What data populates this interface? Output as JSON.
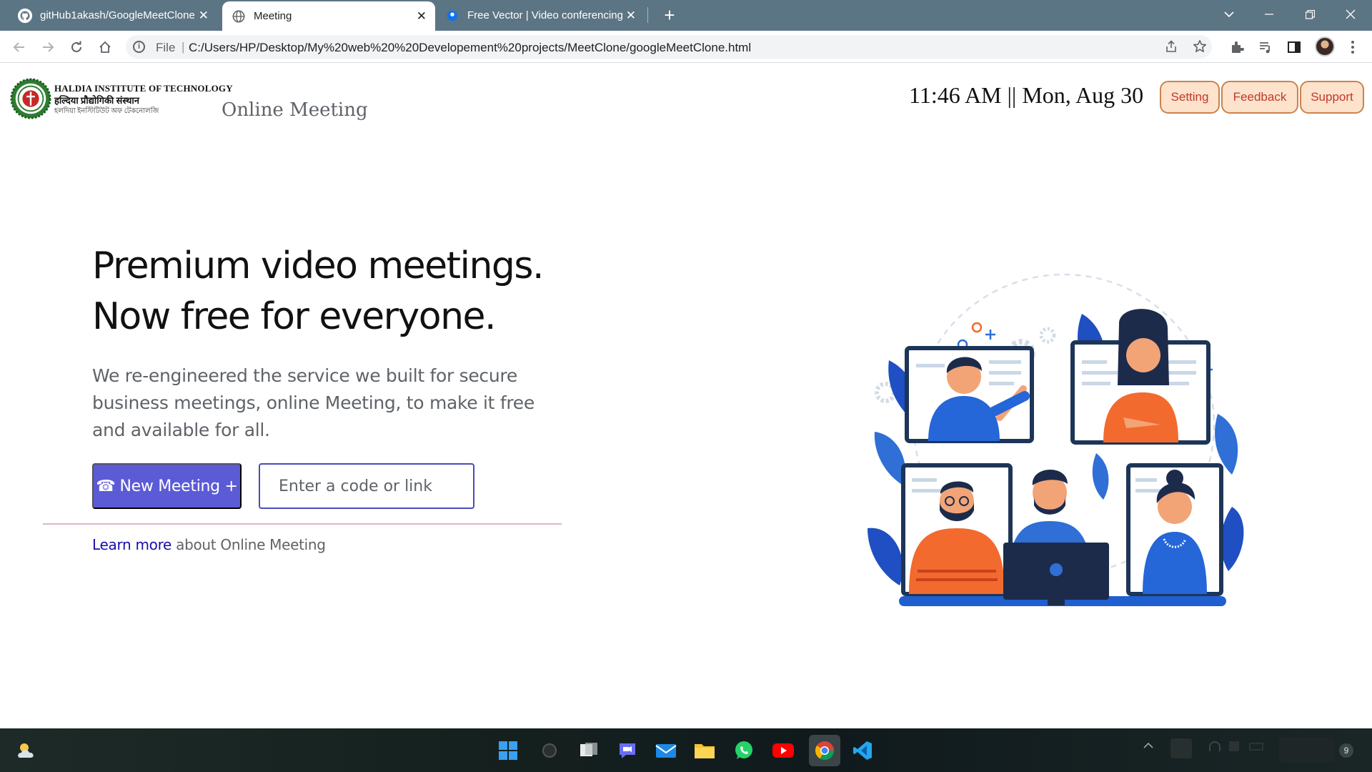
{
  "browser": {
    "tabs": [
      {
        "title": "gitHub1akash/GoogleMeetClone",
        "icon": "github-icon",
        "close": "✕"
      },
      {
        "title": "Meeting",
        "icon": "globe-icon",
        "close": "✕"
      },
      {
        "title": "Free Vector | Video conferencing",
        "icon": "freepik-icon",
        "close": "✕"
      }
    ],
    "new_tab": "+",
    "address": {
      "scheme_label": "File",
      "separator": "|",
      "url": "C:/Users/HP/Desktop/My%20web%20%20Developement%20projects/MeetClone/googleMeetClone.html"
    }
  },
  "header": {
    "institute_en": "HALDIA INSTITUTE OF TECHNOLOGY",
    "institute_hi": "हल्दिया प्रौद्योगिकी संस्थान",
    "institute_bn": "হলদিয়া ইনস্টিটিউট অফ টেকনোলজি",
    "brand": "Online Meeting",
    "clock": "11:46 AM || Mon, Aug 30",
    "buttons": {
      "setting": "Setting",
      "feedback": "Feedback",
      "support": "Support"
    }
  },
  "hero": {
    "headline_line1": "Premium video meetings.",
    "headline_line2": "Now free for everyone.",
    "subtext": "We re-engineered the service we built for secure business meetings, online Meeting, to make it free and available for all.",
    "new_meeting_icon": "☎",
    "new_meeting_label": "New Meeting +",
    "code_placeholder": "Enter a code or link",
    "learn_link": "Learn more",
    "learn_rest": " about Online Meeting"
  },
  "colors": {
    "primary_button": "#5b5bd6",
    "header_button_bg": "#fde2cc",
    "header_button_text": "#c0392b",
    "link": "#1a0dab",
    "tabbar": "#5c7584"
  }
}
